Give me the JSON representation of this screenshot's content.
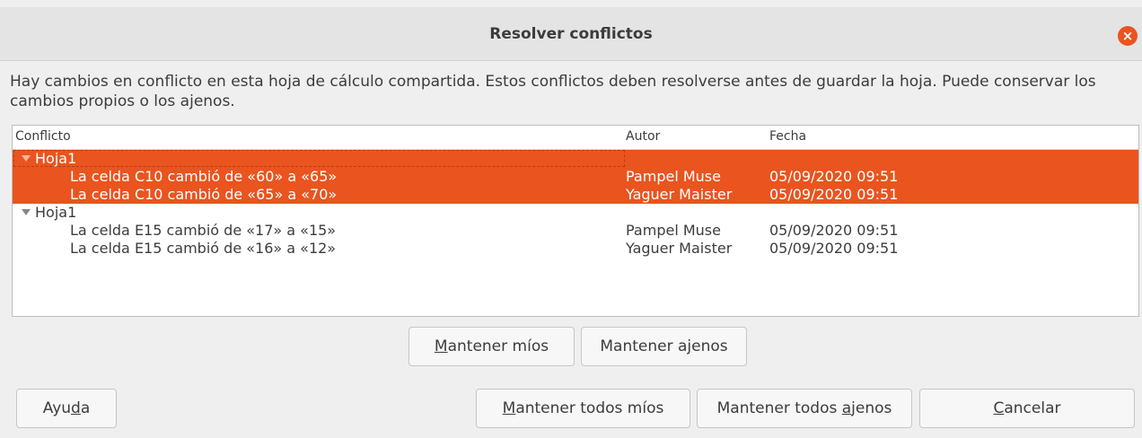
{
  "window": {
    "title": "Resolver conflictos",
    "close_glyph": "×",
    "accent_color": "#e9541f"
  },
  "message": "Hay cambios en conflicto en esta hoja de cálculo compartida. Estos conflictos deben resolverse antes de guardar la hoja. Puede conservar los cambios propios o los ajenos.",
  "tree": {
    "columns": [
      "Conflicto",
      "Autor",
      "Fecha"
    ],
    "groups": [
      {
        "label": "Hoja1",
        "selected": true,
        "rows": [
          {
            "conflict": "La celda C10 cambió de «60» a «65»",
            "author": "Pampel Muse",
            "date": "05/09/2020 09:51"
          },
          {
            "conflict": "La celda C10 cambió de «65» a «70»",
            "author": "Yaguer Maister",
            "date": "05/09/2020 09:51"
          }
        ]
      },
      {
        "label": "Hoja1",
        "selected": false,
        "rows": [
          {
            "conflict": "La celda E15 cambió de «17» a «15»",
            "author": "Pampel Muse",
            "date": "05/09/2020 09:51"
          },
          {
            "conflict": "La celda E15 cambió de «16» a «12»",
            "author": "Yaguer Maister",
            "date": "05/09/2020 09:51"
          }
        ]
      }
    ]
  },
  "buttons": {
    "keep_mine": {
      "pre": "",
      "mn": "M",
      "post": "antener míos"
    },
    "keep_others": {
      "pre": "Mantener a",
      "mn": "j",
      "post": "enos"
    },
    "help": {
      "pre": "Ayu",
      "mn": "d",
      "post": "a"
    },
    "keep_all_mine": {
      "pre": "",
      "mn": "M",
      "post": "antener todos míos"
    },
    "keep_all_others": {
      "pre": "Mantener todos ",
      "mn": "a",
      "post": "jenos"
    },
    "cancel": {
      "pre": "",
      "mn": "C",
      "post": "ancelar"
    }
  }
}
